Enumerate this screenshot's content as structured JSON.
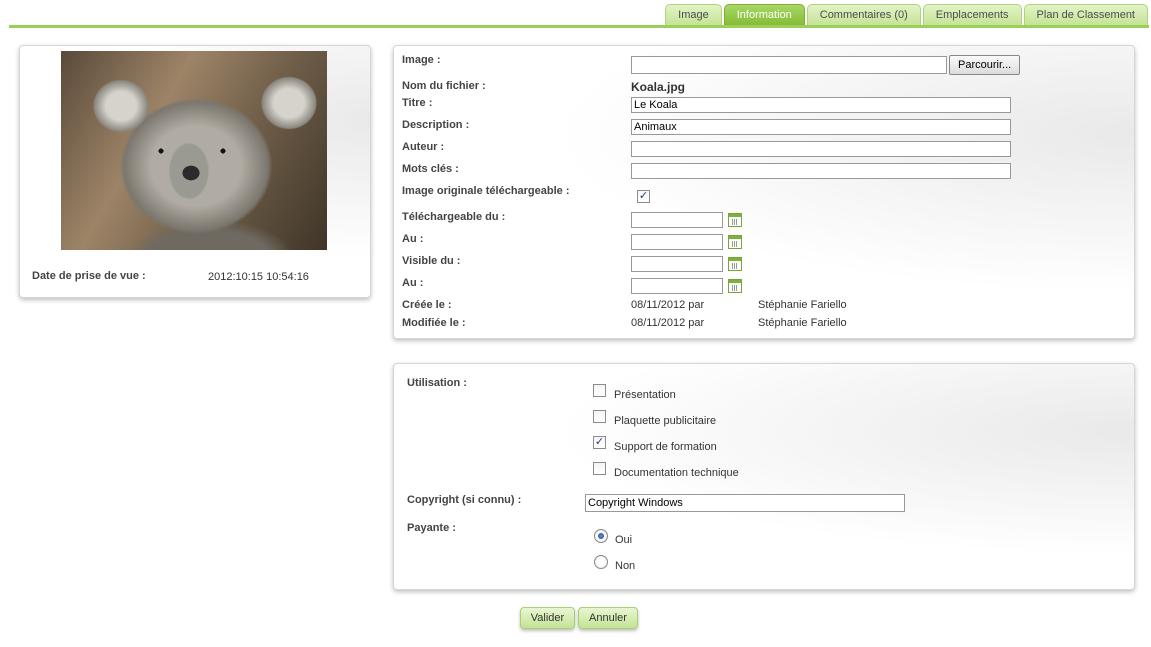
{
  "tabs": [
    "Image",
    "Information",
    "Commentaires (0)",
    "Emplacements",
    "Plan de Classement"
  ],
  "active_tab": "Information",
  "preview": {
    "date_label": "Date de prise de vue :",
    "date_value": "2012:10:15 10:54:16"
  },
  "info": {
    "image_label": "Image :",
    "browse_label": "Parcourir...",
    "filename_label": "Nom du fichier :",
    "filename_value": "Koala.jpg",
    "title_label": "Titre :",
    "title_value": "Le Koala",
    "description_label": "Description :",
    "description_value": "Animaux",
    "author_label": "Auteur :",
    "author_value": "",
    "keywords_label": "Mots clés :",
    "keywords_value": "",
    "downloadable_label": "Image originale téléchargeable :",
    "downloadable_checked": true,
    "download_from_label": "Téléchargeable du :",
    "download_to_label": "Au :",
    "visible_from_label": "Visible du :",
    "visible_to_label": "Au :",
    "created_label": "Créée le :",
    "created_date": "08/11/2012 par",
    "created_by": "Stéphanie Fariello",
    "modified_label": "Modifiée le :",
    "modified_date": "08/11/2012 par",
    "modified_by": "Stéphanie Fariello"
  },
  "usage": {
    "usage_label": "Utilisation :",
    "options": [
      {
        "label": "Présentation",
        "checked": false
      },
      {
        "label": "Plaquette publicitaire",
        "checked": false
      },
      {
        "label": "Support de formation",
        "checked": true
      },
      {
        "label": "Documentation technique",
        "checked": false
      }
    ],
    "copyright_label": "Copyright (si connu) :",
    "copyright_value": "Copyright Windows",
    "paying_label": "Payante :",
    "paying_options": [
      {
        "label": "Oui",
        "selected": true
      },
      {
        "label": "Non",
        "selected": false
      }
    ]
  },
  "actions": {
    "validate_label": "Valider",
    "cancel_label": "Annuler"
  }
}
